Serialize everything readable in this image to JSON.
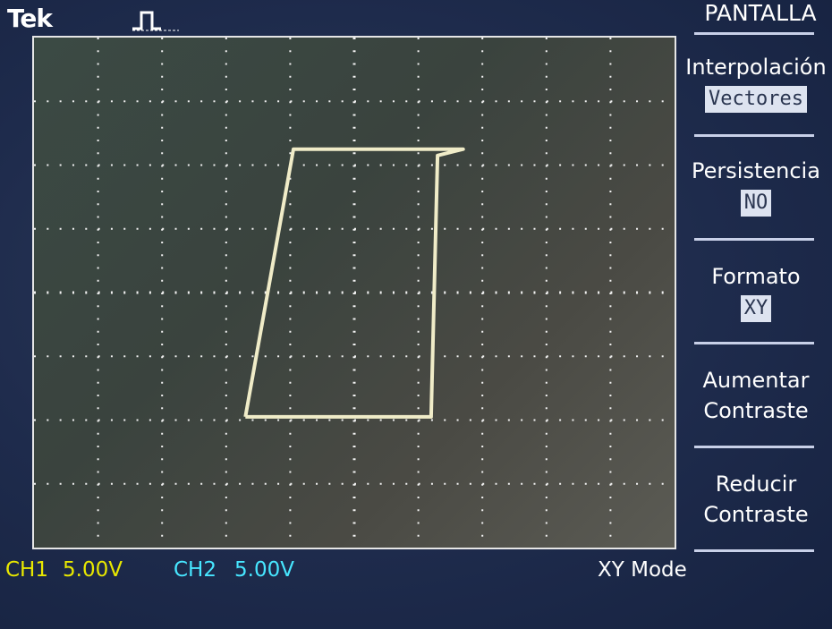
{
  "header": {
    "brand": "Tek"
  },
  "menu": {
    "title": "PANTALLA",
    "items": [
      {
        "label": "Interpolación",
        "value": "Vectores"
      },
      {
        "label": "Persistencia",
        "value": "NO"
      },
      {
        "label": "Formato",
        "value": "XY"
      },
      {
        "label": "Aumentar\nContraste"
      },
      {
        "label": "Reducir\nContraste"
      }
    ]
  },
  "status": {
    "ch1_name": "CH1",
    "ch1_scale": "5.00V",
    "ch2_name": "CH2",
    "ch2_scale": "5.00V",
    "mode": "XY Mode"
  },
  "colors": {
    "ch1": "#e8e800",
    "ch2": "#47e6ff",
    "trace": "#f0ecc8",
    "grid": "#f2f2f2"
  },
  "chart_data": {
    "type": "line",
    "x_divisions": 10,
    "y_divisions": 8,
    "series": [
      {
        "x": [
          -1.7,
          -0.95,
          -0.9,
          1.2,
          1.3,
          1.7,
          1.3,
          1.2,
          -0.95,
          -1.7
        ],
        "y": [
          -1.95,
          -1.95,
          -1.95,
          -1.95,
          2.15,
          2.25,
          2.25,
          2.25,
          2.25,
          -1.95
        ]
      }
    ]
  }
}
